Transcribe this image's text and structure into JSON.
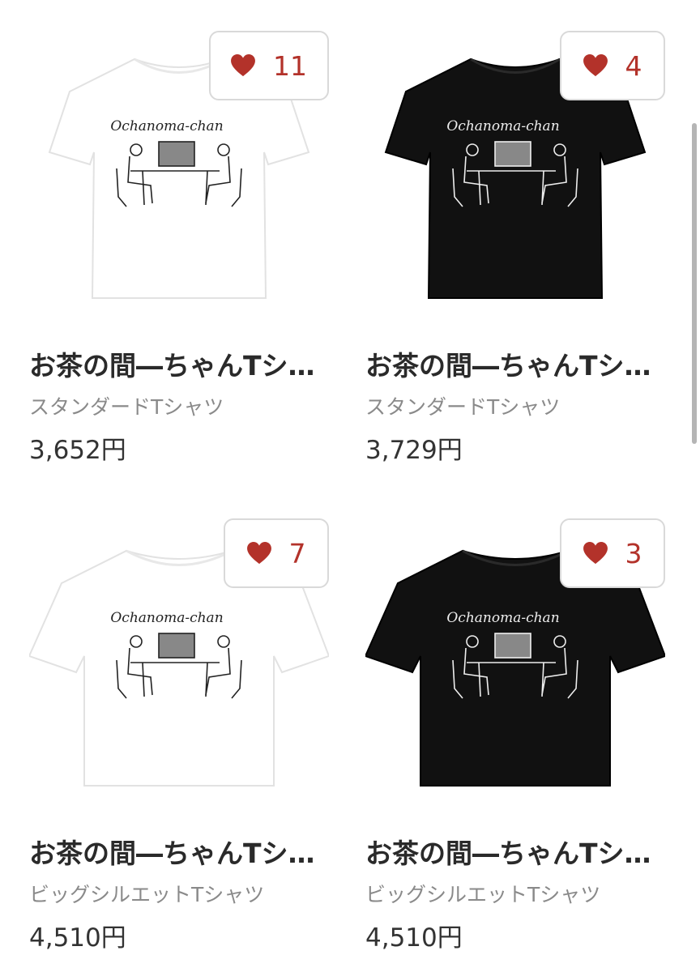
{
  "products": [
    {
      "title": "お茶の間―ちゃんTシ…",
      "type": "スタンダードTシャツ",
      "price": "3,652円",
      "likes": "11",
      "shirt_color": "#ffffff",
      "art_color": "#222222",
      "shirt_print": "Ochanoma-chan"
    },
    {
      "title": "お茶の間―ちゃんTシ…",
      "type": "スタンダードTシャツ",
      "price": "3,729円",
      "likes": "4",
      "shirt_color": "#111111",
      "art_color": "#eeeeee",
      "shirt_print": "Ochanoma-chan"
    },
    {
      "title": "お茶の間―ちゃんTシ…",
      "type": "ビッグシルエットTシャツ",
      "price": "4,510円",
      "likes": "7",
      "shirt_color": "#ffffff",
      "art_color": "#222222",
      "shirt_print": "Ochanoma-chan"
    },
    {
      "title": "お茶の間―ちゃんTシ…",
      "type": "ビッグシルエットTシャツ",
      "price": "4,510円",
      "likes": "3",
      "shirt_color": "#111111",
      "art_color": "#eeeeee",
      "shirt_print": "Ochanoma-chan"
    }
  ],
  "icons": {
    "like": "heart-icon"
  },
  "colors": {
    "heart": "#b3322a",
    "badge_border": "#d9d9d9"
  }
}
